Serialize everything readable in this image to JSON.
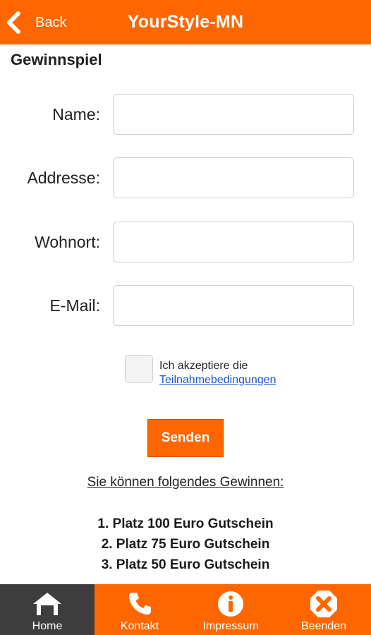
{
  "header": {
    "back_label": "Back",
    "title": "YourStyle-MN"
  },
  "page": {
    "title": "Gewinnspiel"
  },
  "form": {
    "fields": [
      {
        "label": "Name:",
        "value": "",
        "placeholder": ""
      },
      {
        "label": "Addresse:",
        "value": "",
        "placeholder": ""
      },
      {
        "label": "Wohnort:",
        "value": "",
        "placeholder": ""
      },
      {
        "label": "E-Mail:",
        "value": "",
        "placeholder": ""
      }
    ],
    "accept_text": "Ich akzeptiere die",
    "terms_link": "Teilnahmebedingungen",
    "accepted": false,
    "submit_label": "Senden"
  },
  "prizes": {
    "heading": "Sie können folgendes Gewinnen:",
    "items": [
      "1. Platz 100 Euro Gutschein",
      "2. Platz 75 Euro Gutschein",
      "3. Platz 50 Euro Gutschein"
    ]
  },
  "bottom_nav": {
    "items": [
      {
        "label": "Home",
        "icon": "home-icon",
        "active": true
      },
      {
        "label": "Kontakt",
        "icon": "phone-icon",
        "active": false
      },
      {
        "label": "Impressum",
        "icon": "info-icon",
        "active": false
      },
      {
        "label": "Beenden",
        "icon": "close-icon",
        "active": false
      }
    ]
  },
  "colors": {
    "accent": "#ff6600",
    "active_tab": "#3d3d3d",
    "link": "#1a56c8"
  }
}
